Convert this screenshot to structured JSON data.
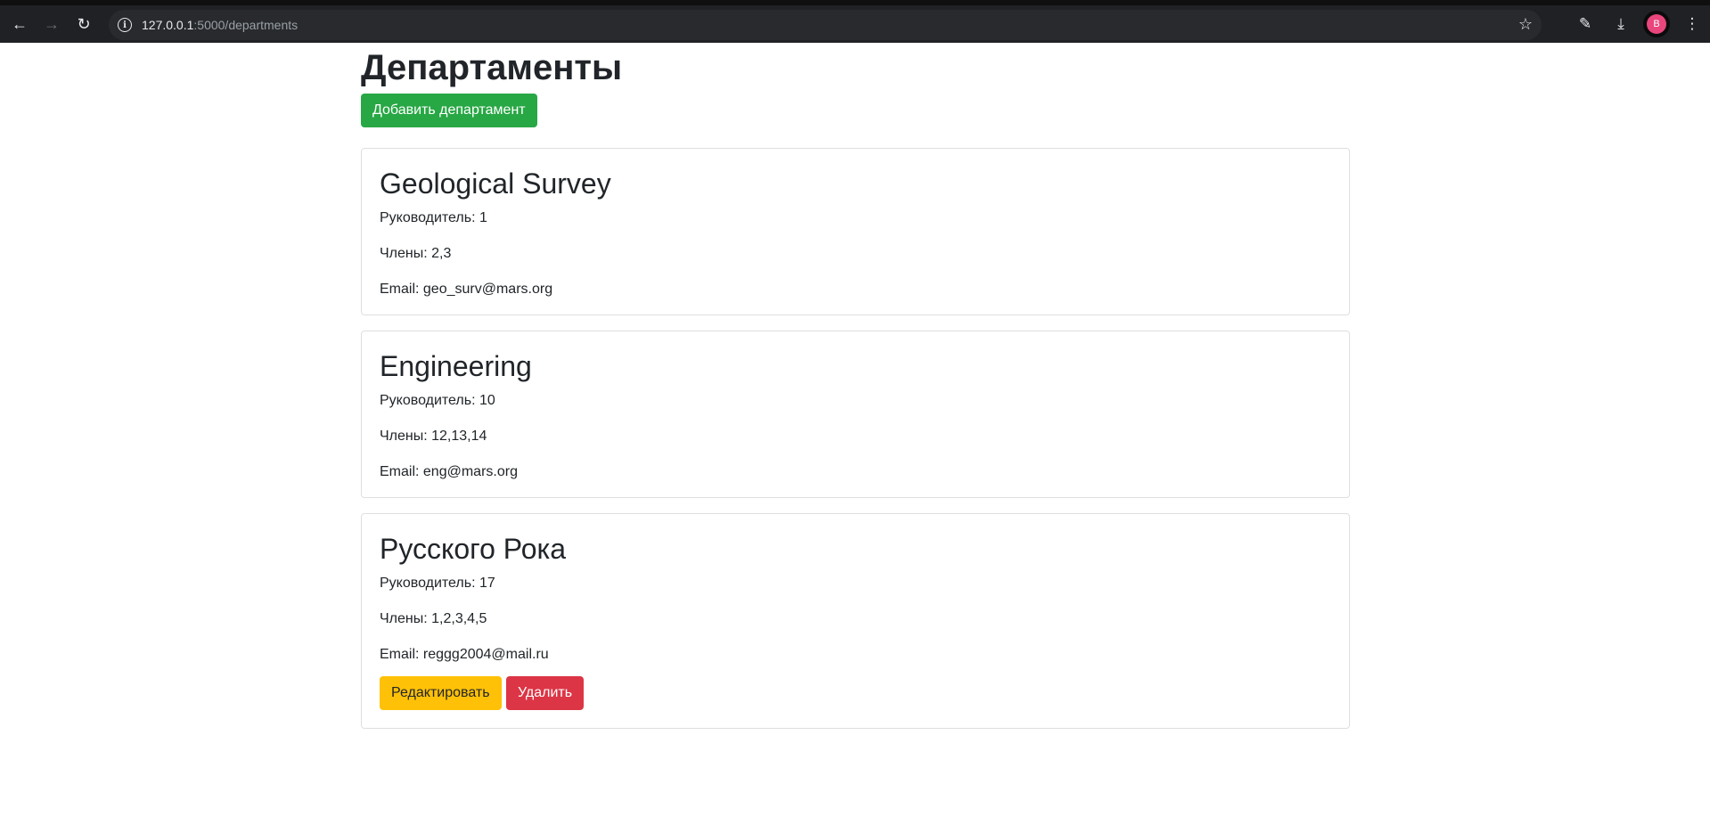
{
  "browser": {
    "url_host": "127.0.0.1",
    "url_path": ":5000/departments",
    "avatar_letter": "B"
  },
  "page": {
    "title": "Департаменты",
    "add_button": "Добавить департамент"
  },
  "departments": [
    {
      "name": "Geological Survey",
      "leader": "Руководитель: 1",
      "members": "Члены: 2,3",
      "email": "Email: geo_surv@mars.org"
    },
    {
      "name": "Engineering",
      "leader": "Руководитель: 10",
      "members": "Члены: 12,13,14",
      "email": "Email: eng@mars.org"
    },
    {
      "name": "Русского Рока",
      "leader": "Руководитель: 17",
      "members": "Члены: 1,2,3,4,5",
      "email": "Email: reggg2004@mail.ru",
      "edit_button": "Редактировать",
      "delete_button": "Удалить"
    }
  ],
  "colors": {
    "success": "#28a745",
    "warning": "#ffc107",
    "danger": "#dc3545"
  }
}
